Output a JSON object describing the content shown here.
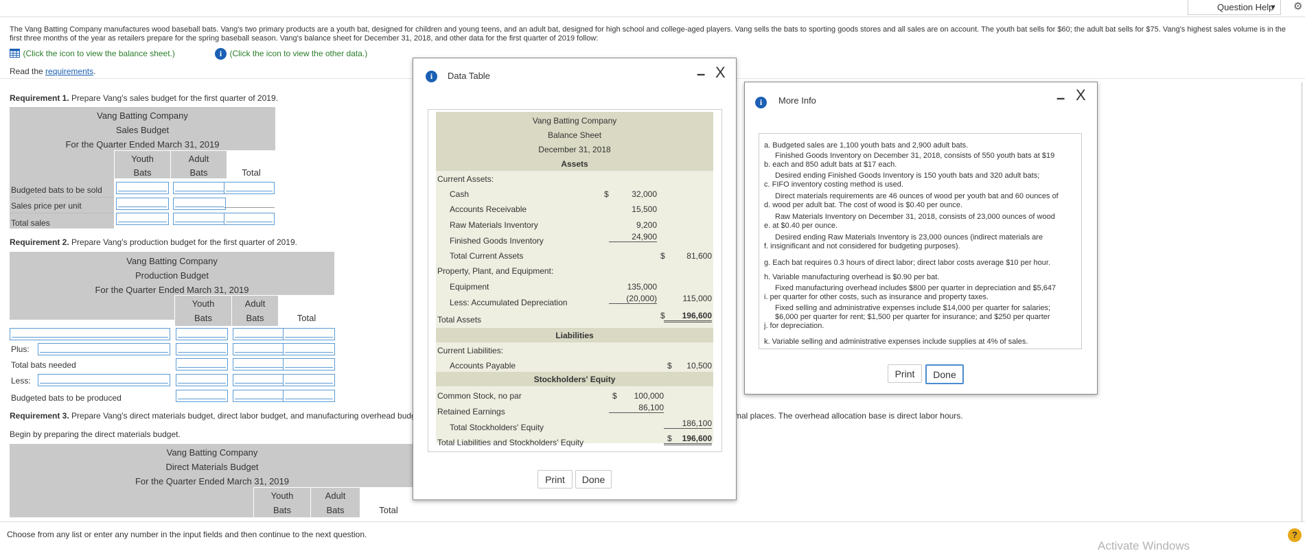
{
  "header": {
    "question_help": "Question Help"
  },
  "problem": {
    "intro": "The Vang Batting Company manufactures wood baseball bats. Vang's two primary products are a youth bat, designed for children and young teens, and an adult bat, designed for high school and college-aged players. Vang sells the bats to sporting goods stores and all sales are on account. The youth bat sells for $60; the adult bat sells for $75. Vang's highest sales volume is in the first three months of the year as retailers prepare for the spring baseball season. Vang's balance sheet for December 31, 2018, and other data for the first quarter of 2019 follow:",
    "balance_link": "(Click the icon to view the balance sheet.)",
    "other_link": "(Click the icon to view the other data.)",
    "read_prefix": "Read the ",
    "read_link": "requirements",
    "read_suffix": "."
  },
  "req1": {
    "label_bold": "Requirement 1.",
    "label_text": " Prepare Vang's sales budget for the first quarter of 2019.",
    "company": "Vang Batting Company",
    "title": "Sales Budget",
    "period": "For the Quarter Ended March 31, 2019",
    "col_youth_1": "Youth",
    "col_youth_2": "Bats",
    "col_adult_1": "Adult",
    "col_adult_2": "Bats",
    "col_total": "Total",
    "rows": [
      "Budgeted bats to be sold",
      "Sales price per unit",
      "Total sales"
    ]
  },
  "req2": {
    "label_bold": "Requirement 2.",
    "label_text": " Prepare Vang's production budget for the first quarter of 2019.",
    "company": "Vang Batting Company",
    "title": "Production Budget",
    "period": "For the Quarter Ended March 31, 2019",
    "col_youth_1": "Youth",
    "col_youth_2": "Bats",
    "col_adult_1": "Adult",
    "col_adult_2": "Bats",
    "col_total": "Total",
    "plus": "Plus:",
    "total_needed": "Total bats needed",
    "less": "Less:",
    "produced": "Budgeted bats to be produced"
  },
  "req3": {
    "label_bold": "Requirement 3.",
    "label_text": " Prepare Vang's direct materials budget, direct labor budget, and manufacturing overhead budge",
    "label_tail": "mal places. The overhead allocation base is direct labor hours.",
    "begin": "Begin by preparing the direct materials budget.",
    "company": "Vang Batting Company",
    "title": "Direct Materials Budget",
    "period": "For the Quarter Ended March 31, 2019",
    "col_youth_1": "Youth",
    "col_youth_2": "Bats",
    "col_adult_1": "Adult",
    "col_adult_2": "Bats",
    "col_total": "Total"
  },
  "footer": {
    "instruction": "Choose from any list or enter any number in the input fields and then continue to the next question.",
    "watermark": "Activate Windows"
  },
  "data_table": {
    "title": "Data Table",
    "minimize": "–",
    "close": "X",
    "company": "Vang Batting Company",
    "sheet": "Balance Sheet",
    "date": "December 31, 2018",
    "assets": "Assets",
    "current_assets": "Current Assets:",
    "cash": "Cash",
    "cash_sign": "$",
    "cash_val": "32,000",
    "ar": "Accounts Receivable",
    "ar_val": "15,500",
    "rmi": "Raw Materials Inventory",
    "rmi_val": "9,200",
    "fgi": "Finished Goods Inventory",
    "fgi_val": "24,900",
    "tca": "Total Current Assets",
    "tca_sign": "$",
    "tca_val": "81,600",
    "ppe": "Property, Plant, and Equipment:",
    "equip": "Equipment",
    "equip_val": "135,000",
    "accdep": "Less: Accumulated Depreciation",
    "accdep_val": "(20,000)",
    "ppe_val": "115,000",
    "ta": "Total Assets",
    "ta_sign": "$",
    "ta_val": "196,600",
    "liabilities": "Liabilities",
    "cl": "Current Liabilities:",
    "ap": "Accounts Payable",
    "ap_sign": "$",
    "ap_val": "10,500",
    "se": "Stockholders' Equity",
    "cs": "Common Stock, no par",
    "cs_sign": "$",
    "cs_val": "100,000",
    "re": "Retained Earnings",
    "re_val": "86,100",
    "tse": "Total Stockholders' Equity",
    "tse_val": "186,100",
    "tlse": "Total Liabilities and Stockholders' Equity",
    "tlse_sign": "$",
    "tlse_val": "196,600",
    "print": "Print",
    "done": "Done"
  },
  "more_info": {
    "title": "More Info",
    "minimize": "–",
    "close": "X",
    "items": {
      "a": "a. Budgeted sales are 1,100 youth bats and 2,900 adult bats.",
      "b1": "Finished Goods Inventory on December 31, 2018, consists of 550 youth bats at $19",
      "b2": "b. each and 850 adult bats at $17 each.",
      "c1": "Desired ending Finished Goods Inventory is 150 youth bats and 320 adult bats;",
      "c2": "c. FIFO inventory costing method is used.",
      "d1": "Direct materials requirements are 46 ounces of wood per youth bat and 60 ounces of",
      "d2": "d. wood per adult bat. The cost of wood is $0.40 per ounce.",
      "e1": "Raw Materials Inventory on December 31, 2018, consists of 23,000 ounces of wood",
      "e2": "e. at $0.40 per ounce.",
      "f1": "Desired ending Raw Materials Inventory is 23,000 ounces (indirect materials are",
      "f2": "f. insignificant and not considered for budgeting purposes).",
      "g": "g. Each bat requires 0.3 hours of direct labor; direct labor costs average $10 per hour.",
      "h": "h. Variable manufacturing overhead is $0.90 per bat.",
      "i1": "Fixed manufacturing overhead includes $800 per quarter in depreciation and $5,647",
      "i2": "i. per quarter for other costs, such as insurance and property taxes.",
      "j1": "Fixed selling and administrative expenses include $14,000 per quarter for salaries;",
      "j2": "$6,000 per quarter for rent; $1,500 per quarter for insurance; and $250 per quarter",
      "j3": "j. for depreciation.",
      "k": "k. Variable selling and administrative expenses include supplies at 4% of sales."
    },
    "print": "Print",
    "done": "Done"
  }
}
